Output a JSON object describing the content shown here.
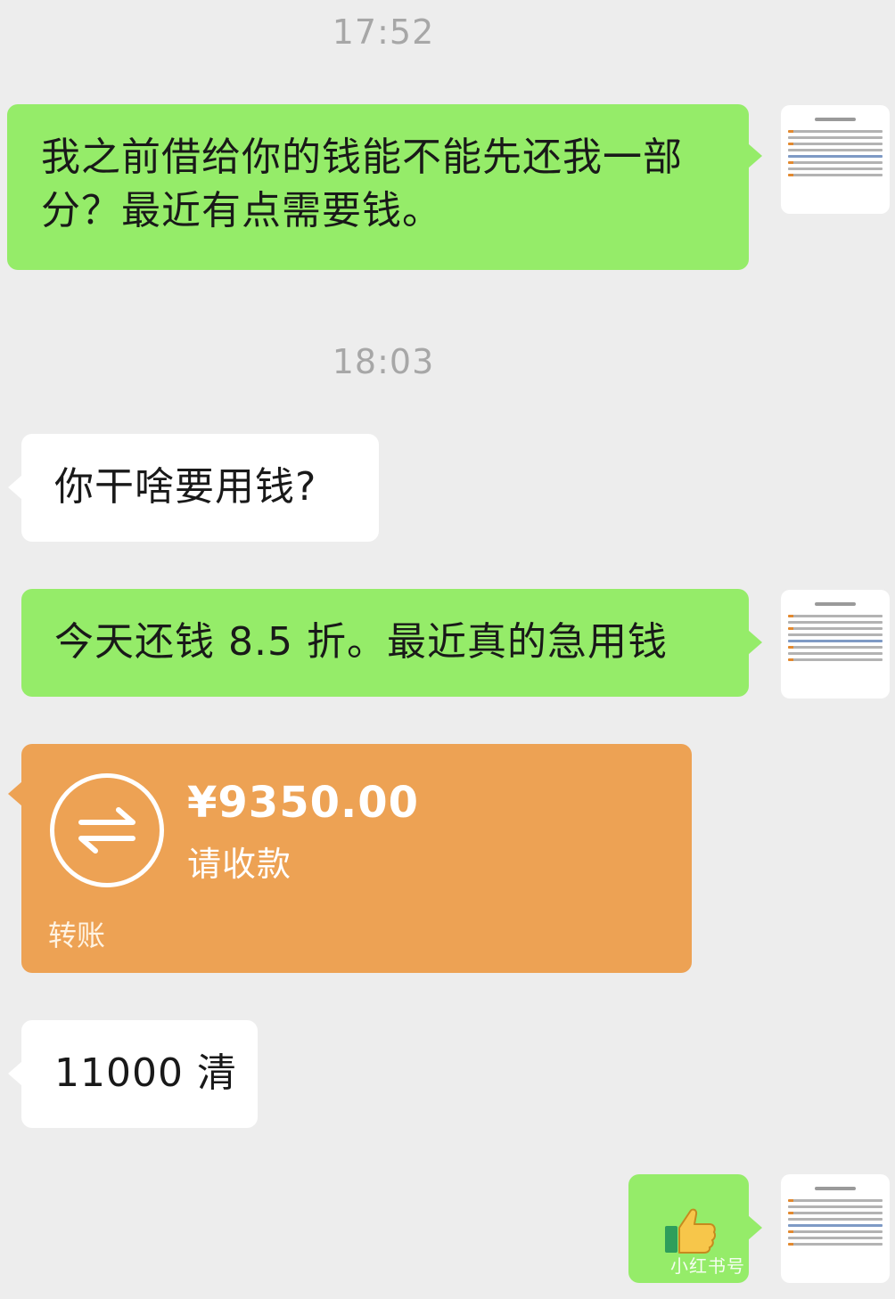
{
  "timestamps": [
    "17:52",
    "18:03"
  ],
  "messages": [
    {
      "side": "right",
      "text": "我之前借给你的钱能不能先还我一部分？最近有点需要钱。"
    },
    {
      "side": "left",
      "text": "你干啥要用钱?"
    },
    {
      "side": "right",
      "text": "今天还钱 8.5 折。最近真的急用钱"
    },
    {
      "side": "left",
      "text": "11000 清"
    }
  ],
  "transfer": {
    "amount": "¥9350.00",
    "status": "请收款",
    "kind": "转账",
    "color": "#eda254"
  },
  "last_message": {
    "side": "right",
    "emoji": "thumbs-up-icon"
  },
  "watermark": "小红书号",
  "colors": {
    "background": "#ededed",
    "sent_bubble": "#95ec69",
    "received_bubble": "#ffffff",
    "timestamp": "#a7a7a7"
  }
}
